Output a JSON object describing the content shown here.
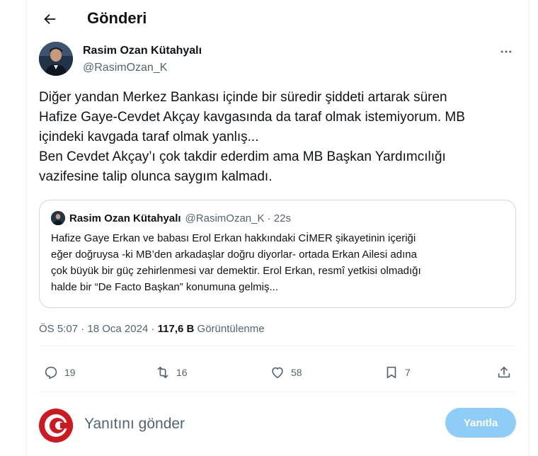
{
  "header": {
    "title": "Gönderi"
  },
  "author": {
    "name": "Rasim Ozan Kütahyalı",
    "handle": "@RasimOzan_K"
  },
  "tweet": {
    "lines": [
      "Diğer yandan Merkez Bankası içinde bir süredir şiddeti artarak süren",
      "Hafize Gaye-Cevdet Akçay kavgasında da taraf olmak istemiyorum. MB",
      "içindeki kavgada taraf olmak yanlış...",
      "Ben Cevdet Akçay’ı çok takdir ederdim ama MB Başkan Yardımcılığı",
      "vazifesine talip olunca saygım kalmadı."
    ]
  },
  "quote": {
    "name": "Rasim Ozan Kütahyalı",
    "handle_time": "@RasimOzan_K · 22s",
    "lines": [
      "Hafize Gaye Erkan ve babası Erol Erkan hakkındaki CİMER şikayetinin içeriği",
      "eğer doğruysa -ki MB’den arkadaşlar doğru diyorlar- ortada Erkan Ailesi adına",
      "çok büyük bir güç zehirlenmesi var demektir. Erol Erkan, resmî yetkisi olmadığı",
      "halde bir “De Facto Başkan” konumuna gelmiş..."
    ]
  },
  "meta": {
    "time": "ÖS 5:07",
    "date": "18 Oca 2024",
    "views_count": "117,6 B",
    "views_label": "Görüntülenme"
  },
  "actions": {
    "replies": "19",
    "reposts": "16",
    "likes": "58",
    "bookmarks": "7"
  },
  "reply": {
    "placeholder": "Yanıtını gönder",
    "button_label": "Yanıtla"
  },
  "icons": {
    "back": "arrow-left-icon",
    "more": "more-horizontal-icon",
    "reply": "comment-icon",
    "repost": "repost-icon",
    "like": "heart-icon",
    "bookmark": "bookmark-icon",
    "share": "share-icon"
  },
  "colors": {
    "text": "#0f1419",
    "secondary": "#536471",
    "button": "#8ecdf8",
    "border": "#cfd9de",
    "logo_red": "#d0191f"
  }
}
